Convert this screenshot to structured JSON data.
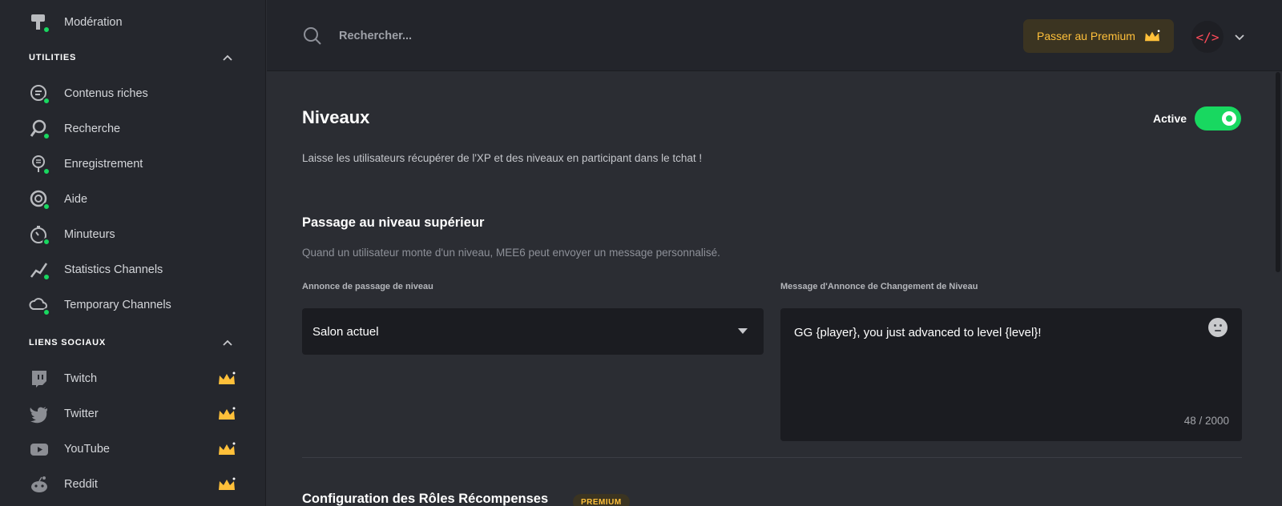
{
  "sidebar": {
    "top_item": {
      "label": "Modération",
      "icon": "moderation-icon"
    },
    "sections": [
      {
        "title": "UTILITIES",
        "items": [
          {
            "label": "Contenus riches",
            "icon": "rich-content-icon"
          },
          {
            "label": "Recherche",
            "icon": "search-icon"
          },
          {
            "label": "Enregistrement",
            "icon": "record-icon"
          },
          {
            "label": "Aide",
            "icon": "help-icon"
          },
          {
            "label": "Minuteurs",
            "icon": "timer-icon"
          },
          {
            "label": "Statistics Channels",
            "icon": "stats-icon"
          },
          {
            "label": "Temporary Channels",
            "icon": "temp-channel-icon"
          }
        ]
      },
      {
        "title": "LIENS SOCIAUX",
        "items": [
          {
            "label": "Twitch",
            "icon": "twitch-icon",
            "premium": true
          },
          {
            "label": "Twitter",
            "icon": "twitter-icon",
            "premium": true
          },
          {
            "label": "YouTube",
            "icon": "youtube-icon",
            "premium": true
          },
          {
            "label": "Reddit",
            "icon": "reddit-icon",
            "premium": true
          }
        ]
      }
    ]
  },
  "header": {
    "search_placeholder": "Rechercher...",
    "premium_button": "Passer au Premium",
    "avatar_glyph": "</>"
  },
  "main": {
    "title": "Niveaux",
    "toggle_label": "Active",
    "toggle_on": true,
    "description": "Laisse les utilisateurs récupérer de l'XP et des niveaux en participant dans le tchat !",
    "levelup": {
      "heading": "Passage au niveau supérieur",
      "description": "Quand un utilisateur monte d'un niveau, MEE6 peut envoyer un message personnalisé.",
      "announce_label": "Annonce de passage de niveau",
      "announce_value": "Salon actuel",
      "message_label": "Message d'Annonce de Changement de Niveau",
      "message_value": "GG {player}, you just advanced to level {level}!",
      "char_count": "48 / 2000"
    },
    "roles": {
      "heading": "Configuration des Rôles Récompenses",
      "badge": "PREMIUM"
    }
  },
  "colors": {
    "accent_green": "#18d860",
    "premium_gold": "#ffc03a",
    "background": "#2b2d33",
    "sidebar": "#25272d"
  }
}
